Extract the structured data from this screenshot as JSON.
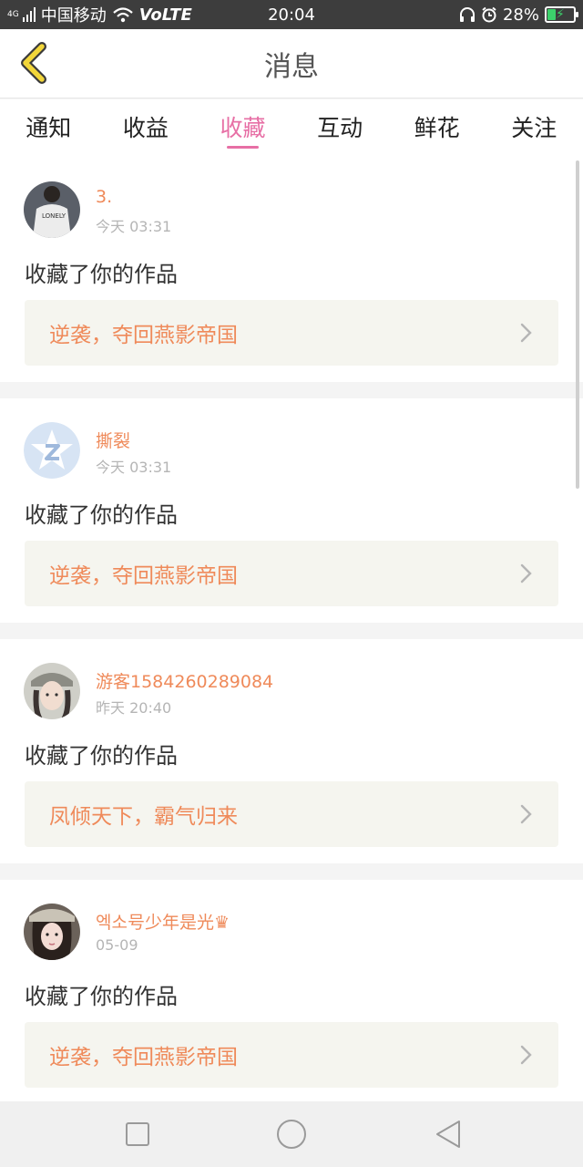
{
  "status_bar": {
    "network_type": "4G",
    "carrier": "中国移动",
    "volte": "VoLTE",
    "time": "20:04",
    "battery": "28%",
    "battery_level": 0.28
  },
  "header": {
    "title": "消息",
    "back_icon": "chevron-left-icon"
  },
  "tabs": [
    {
      "label": "通知",
      "active": false
    },
    {
      "label": "收益",
      "active": false
    },
    {
      "label": "收藏",
      "active": true
    },
    {
      "label": "互动",
      "active": false
    },
    {
      "label": "鲜花",
      "active": false
    },
    {
      "label": "关注",
      "active": false
    }
  ],
  "messages": [
    {
      "username": "3.",
      "time": "今天 03:31",
      "action": "收藏了你的作品",
      "work": "逆袭，夺回燕影帝国"
    },
    {
      "username": "撕裂",
      "time": "今天 03:31",
      "action": "收藏了你的作品",
      "work": "逆袭，夺回燕影帝国"
    },
    {
      "username": "游客1584260289084",
      "time": "昨天 20:40",
      "action": "收藏了你的作品",
      "work": "凤倾天下，霸气归来"
    },
    {
      "username": "엑소号少年是光♛",
      "time": "05-09",
      "action": "收藏了你的作品",
      "work": "逆袭，夺回燕影帝国"
    }
  ],
  "colors": {
    "accent": "#e76fa5",
    "username": "#ef8a5a",
    "back_arrow": "#f2d63a"
  }
}
